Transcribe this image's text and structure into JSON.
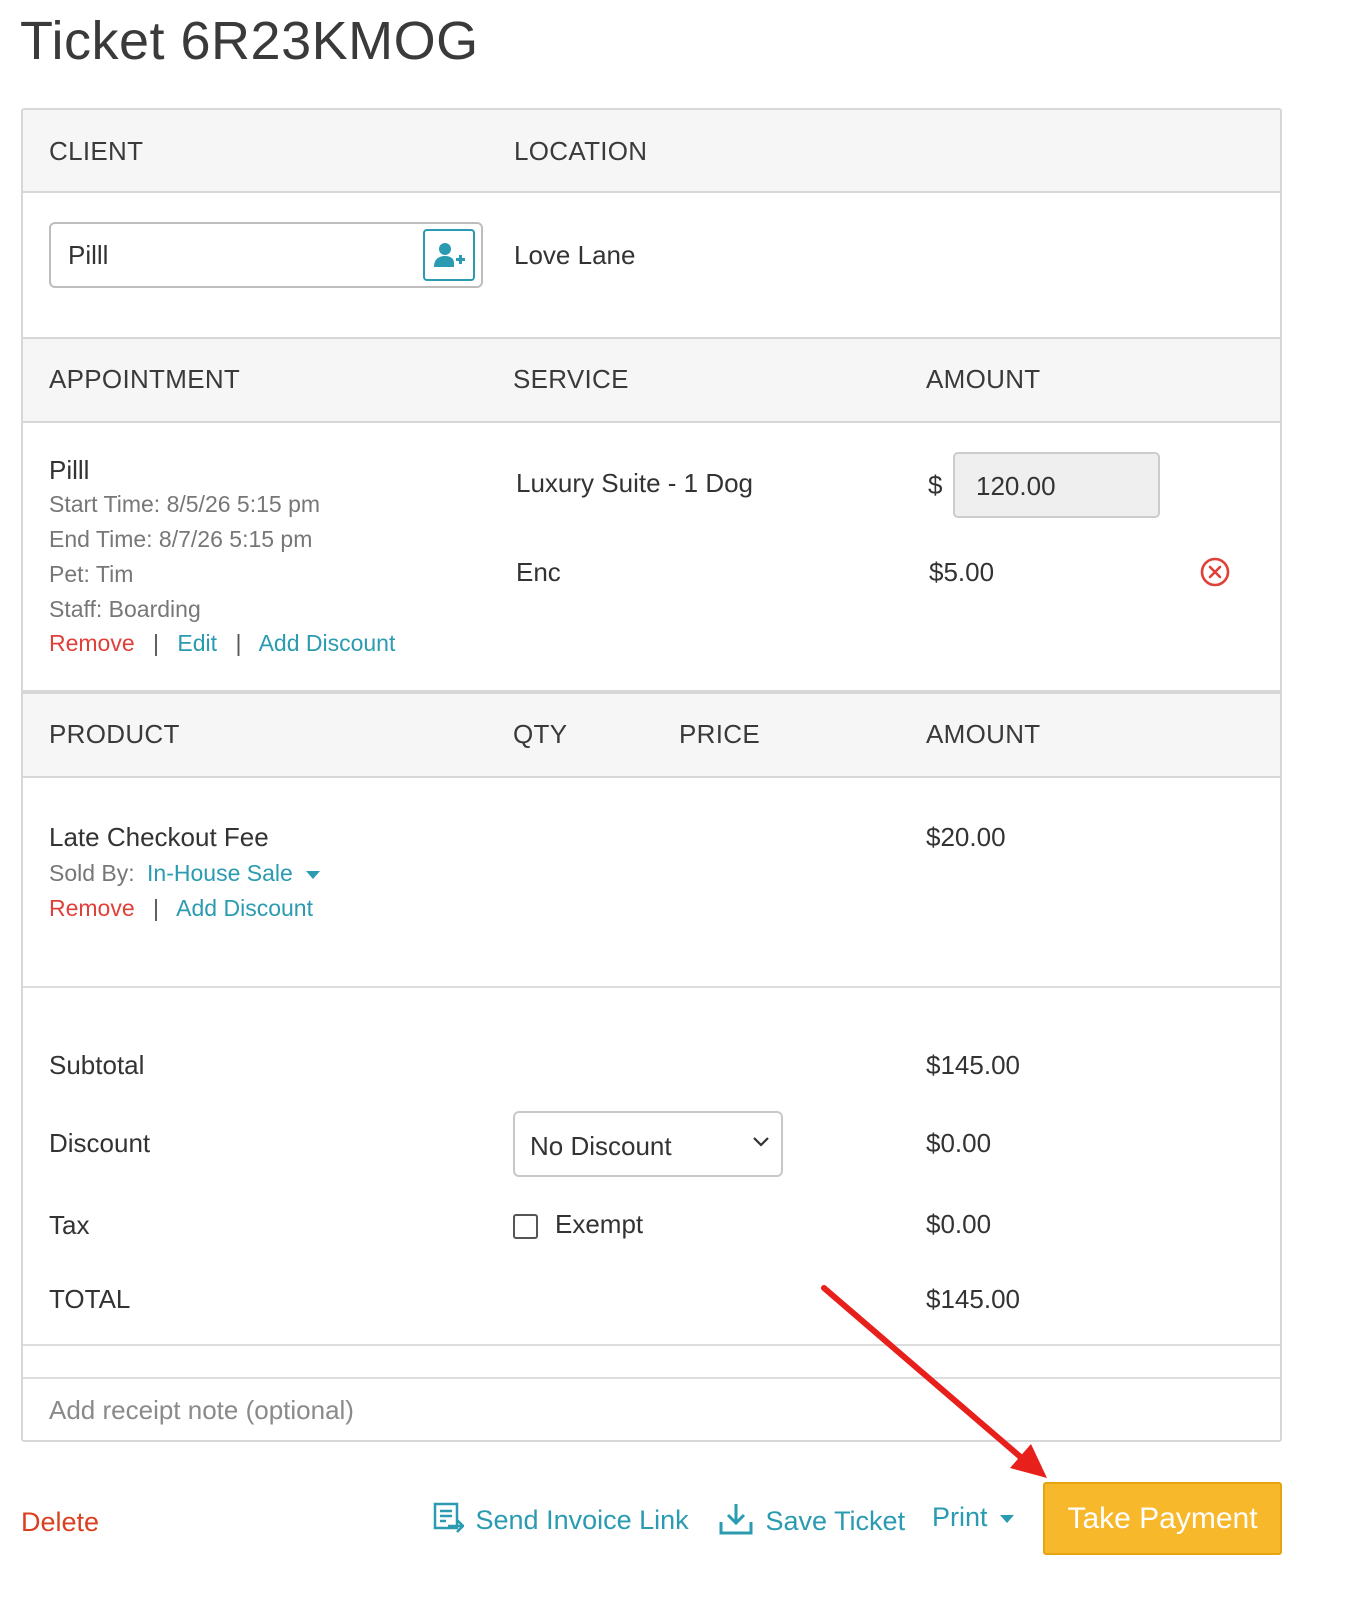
{
  "page": {
    "title": "Ticket 6R23KMOG"
  },
  "client_section": {
    "client_header": "CLIENT",
    "location_header": "LOCATION",
    "client_value": "Pilll",
    "location_value": "Love Lane"
  },
  "appointment_section": {
    "headers": {
      "appointment": "APPOINTMENT",
      "service": "SERVICE",
      "amount": "AMOUNT"
    },
    "client_name": "Pilll",
    "start_time": "Start Time: 8/5/26 5:15 pm",
    "end_time": "End Time: 8/7/26 5:15 pm",
    "pet": "Pet: Tim",
    "staff": "Staff: Boarding",
    "actions": {
      "remove": "Remove",
      "edit": "Edit",
      "add_discount": "Add Discount",
      "separator": "|"
    },
    "services": [
      {
        "name": "Luxury Suite - 1 Dog",
        "currency": "$",
        "amount": "120.00"
      },
      {
        "name": "Enc",
        "amount": "$5.00"
      }
    ]
  },
  "product_section": {
    "headers": {
      "product": "PRODUCT",
      "qty": "QTY",
      "price": "PRICE",
      "amount": "AMOUNT"
    },
    "items": [
      {
        "name": "Late Checkout Fee",
        "sold_by_label": "Sold By:",
        "sold_by_value": "In-House Sale",
        "amount": "$20.00",
        "remove": "Remove",
        "add_discount": "Add Discount"
      }
    ]
  },
  "totals": {
    "subtotal_label": "Subtotal",
    "subtotal_value": "$145.00",
    "discount_label": "Discount",
    "discount_selected": "No Discount",
    "discount_value": "$0.00",
    "tax_label": "Tax",
    "tax_exempt_label": "Exempt",
    "tax_value": "$0.00",
    "total_label": "TOTAL",
    "total_value": "$145.00"
  },
  "receipt_note": {
    "placeholder": "Add receipt note (optional)"
  },
  "footer": {
    "delete": "Delete",
    "send_invoice": "Send Invoice Link",
    "save_ticket": "Save Ticket",
    "print": "Print",
    "take_payment": "Take Payment"
  },
  "colors": {
    "link": "#2a9bb0",
    "danger": "#e0403a",
    "primary_button": "#f7b82c",
    "annotation_arrow": "#e8201c"
  },
  "icons": [
    "add-user-icon",
    "remove-circle-icon",
    "chevron-down-icon",
    "caret-down-icon",
    "invoice-icon",
    "download-icon",
    "annotation-arrow"
  ]
}
